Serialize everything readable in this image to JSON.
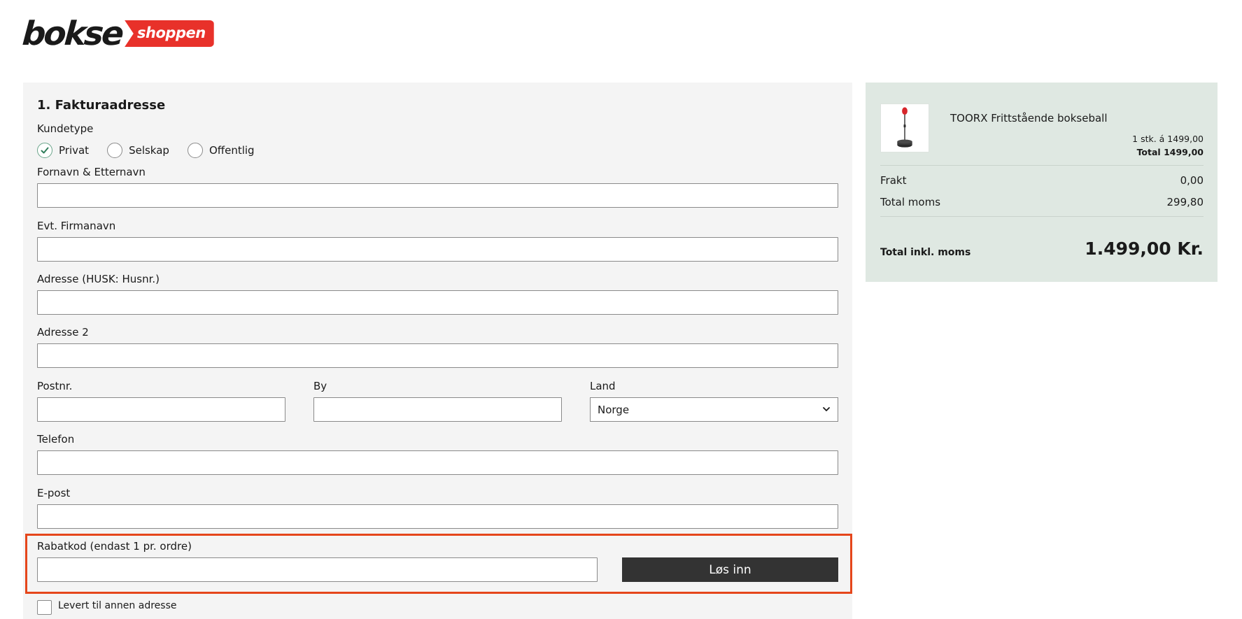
{
  "logo": {
    "part1": "bokse",
    "part2": "shoppen",
    "brand_color": "#e8312a"
  },
  "billing": {
    "title": "1. Fakturaadresse",
    "customer_type_label": "Kundetype",
    "customer_types": [
      {
        "label": "Privat",
        "checked": true
      },
      {
        "label": "Selskap",
        "checked": false
      },
      {
        "label": "Offentlig",
        "checked": false
      }
    ],
    "fields": {
      "name": {
        "label": "Fornavn & Etternavn",
        "value": ""
      },
      "company": {
        "label": "Evt. Firmanavn",
        "value": ""
      },
      "address": {
        "label": "Adresse (HUSK: Husnr.)",
        "value": ""
      },
      "address2": {
        "label": "Adresse 2",
        "value": ""
      },
      "zip": {
        "label": "Postnr.",
        "value": ""
      },
      "city": {
        "label": "By",
        "value": ""
      },
      "country": {
        "label": "Land",
        "value": "Norge"
      },
      "phone": {
        "label": "Telefon",
        "value": ""
      },
      "email": {
        "label": "E-post",
        "value": ""
      }
    },
    "discount": {
      "label": "Rabatkod (endast 1 pr. ordre)",
      "value": "",
      "button": "Løs inn"
    },
    "other_address": {
      "label": "Levert til annen adresse",
      "checked": false
    }
  },
  "summary": {
    "product": {
      "name": "TOORX Frittstående bokseball",
      "qty_price": "1 stk. á 1499,00",
      "line_total": "Total 1499,00",
      "icon": "punching-ball-icon"
    },
    "shipping_label": "Frakt",
    "shipping_value": "0,00",
    "vat_label": "Total moms",
    "vat_value": "299,80",
    "total_label": "Total inkl. moms",
    "total_value": "1.499,00 Kr.",
    "bg_color": "#dfe8e2"
  }
}
